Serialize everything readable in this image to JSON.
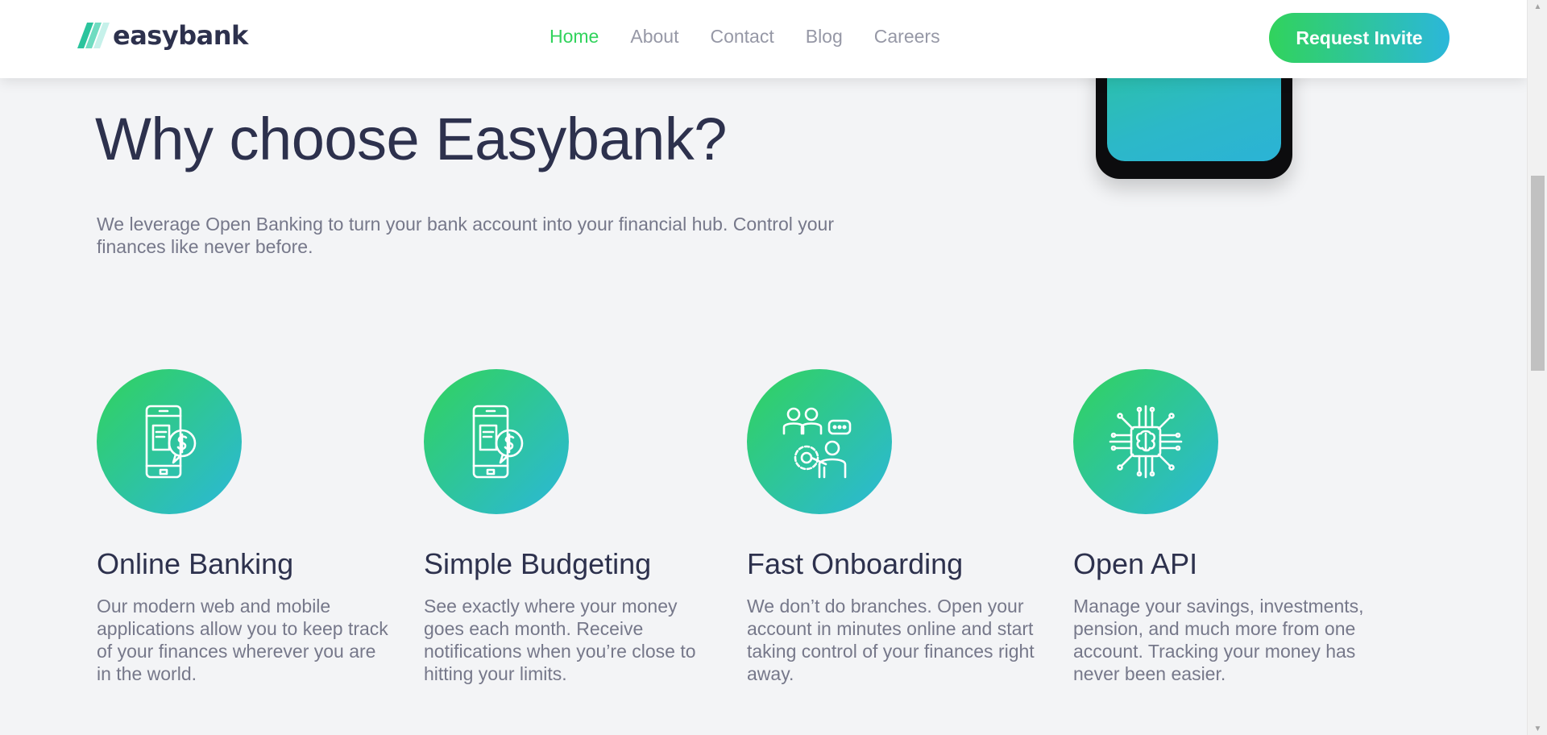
{
  "brand": {
    "name": "easybank"
  },
  "nav": {
    "items": [
      {
        "label": "Home",
        "active": true
      },
      {
        "label": "About",
        "active": false
      },
      {
        "label": "Contact",
        "active": false
      },
      {
        "label": "Blog",
        "active": false
      },
      {
        "label": "Careers",
        "active": false
      }
    ],
    "cta_label": "Request Invite"
  },
  "hero": {
    "title": "Why choose Easybank?",
    "intro": "We leverage Open Banking to turn your bank account into your financial hub. Control your finances like never before."
  },
  "features": [
    {
      "icon": "online-banking-icon",
      "title": "Online Banking",
      "text": "Our modern web and mobile applications allow you to keep track of your finances wherever you are in the world."
    },
    {
      "icon": "budgeting-icon",
      "title": "Simple Budgeting",
      "text": "See exactly where your money goes each month. Receive notifications when you’re close to hitting your limits."
    },
    {
      "icon": "onboarding-icon",
      "title": "Fast Onboarding",
      "text": "We don’t do branches. Open your account in minutes online and start taking control of your finances right away."
    },
    {
      "icon": "api-icon",
      "title": "Open API",
      "text": "Manage your savings, investments, pension, and much more from one account. Tracking your money has never been easier."
    }
  ],
  "colors": {
    "accent_green": "#31d35c",
    "accent_cyan": "#2bb7da",
    "dark_blue": "#2d314d",
    "grayish_blue": "#9698a6",
    "background": "#f3f4f6"
  }
}
